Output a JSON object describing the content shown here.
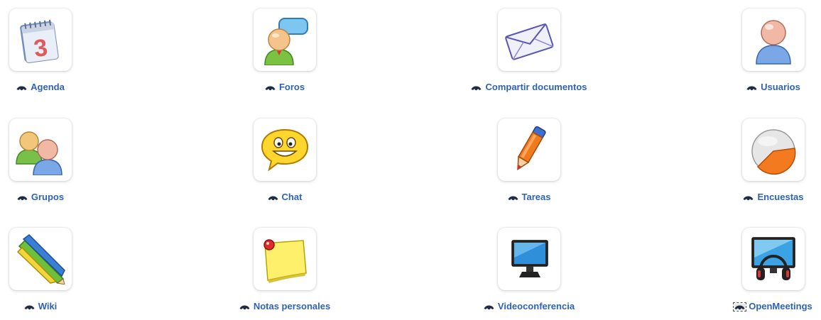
{
  "tools": [
    {
      "key": "agenda",
      "label": "Agenda",
      "icon": "calendar-icon"
    },
    {
      "key": "foros",
      "label": "Foros",
      "icon": "forum-icon"
    },
    {
      "key": "documentos",
      "label": "Compartir documentos",
      "icon": "envelope-icon"
    },
    {
      "key": "usuarios",
      "label": "Usuarios",
      "icon": "user-icon"
    },
    {
      "key": "grupos",
      "label": "Grupos",
      "icon": "group-icon"
    },
    {
      "key": "chat",
      "label": "Chat",
      "icon": "chat-smiley-icon"
    },
    {
      "key": "tareas",
      "label": "Tareas",
      "icon": "pen-icon"
    },
    {
      "key": "encuestas",
      "label": "Encuestas",
      "icon": "pie-chart-icon"
    },
    {
      "key": "wiki",
      "label": "Wiki",
      "icon": "pencils-icon"
    },
    {
      "key": "notas",
      "label": "Notas personales",
      "icon": "sticky-note-icon"
    },
    {
      "key": "videoconferencia",
      "label": "Videoconferencia",
      "icon": "monitor-icon"
    },
    {
      "key": "openmeetings",
      "label": "OpenMeetings",
      "icon": "monitor-headset-icon"
    }
  ],
  "calendar_day": "3",
  "colors": {
    "link": "#2e62b9",
    "eye": "#1f2a44"
  }
}
